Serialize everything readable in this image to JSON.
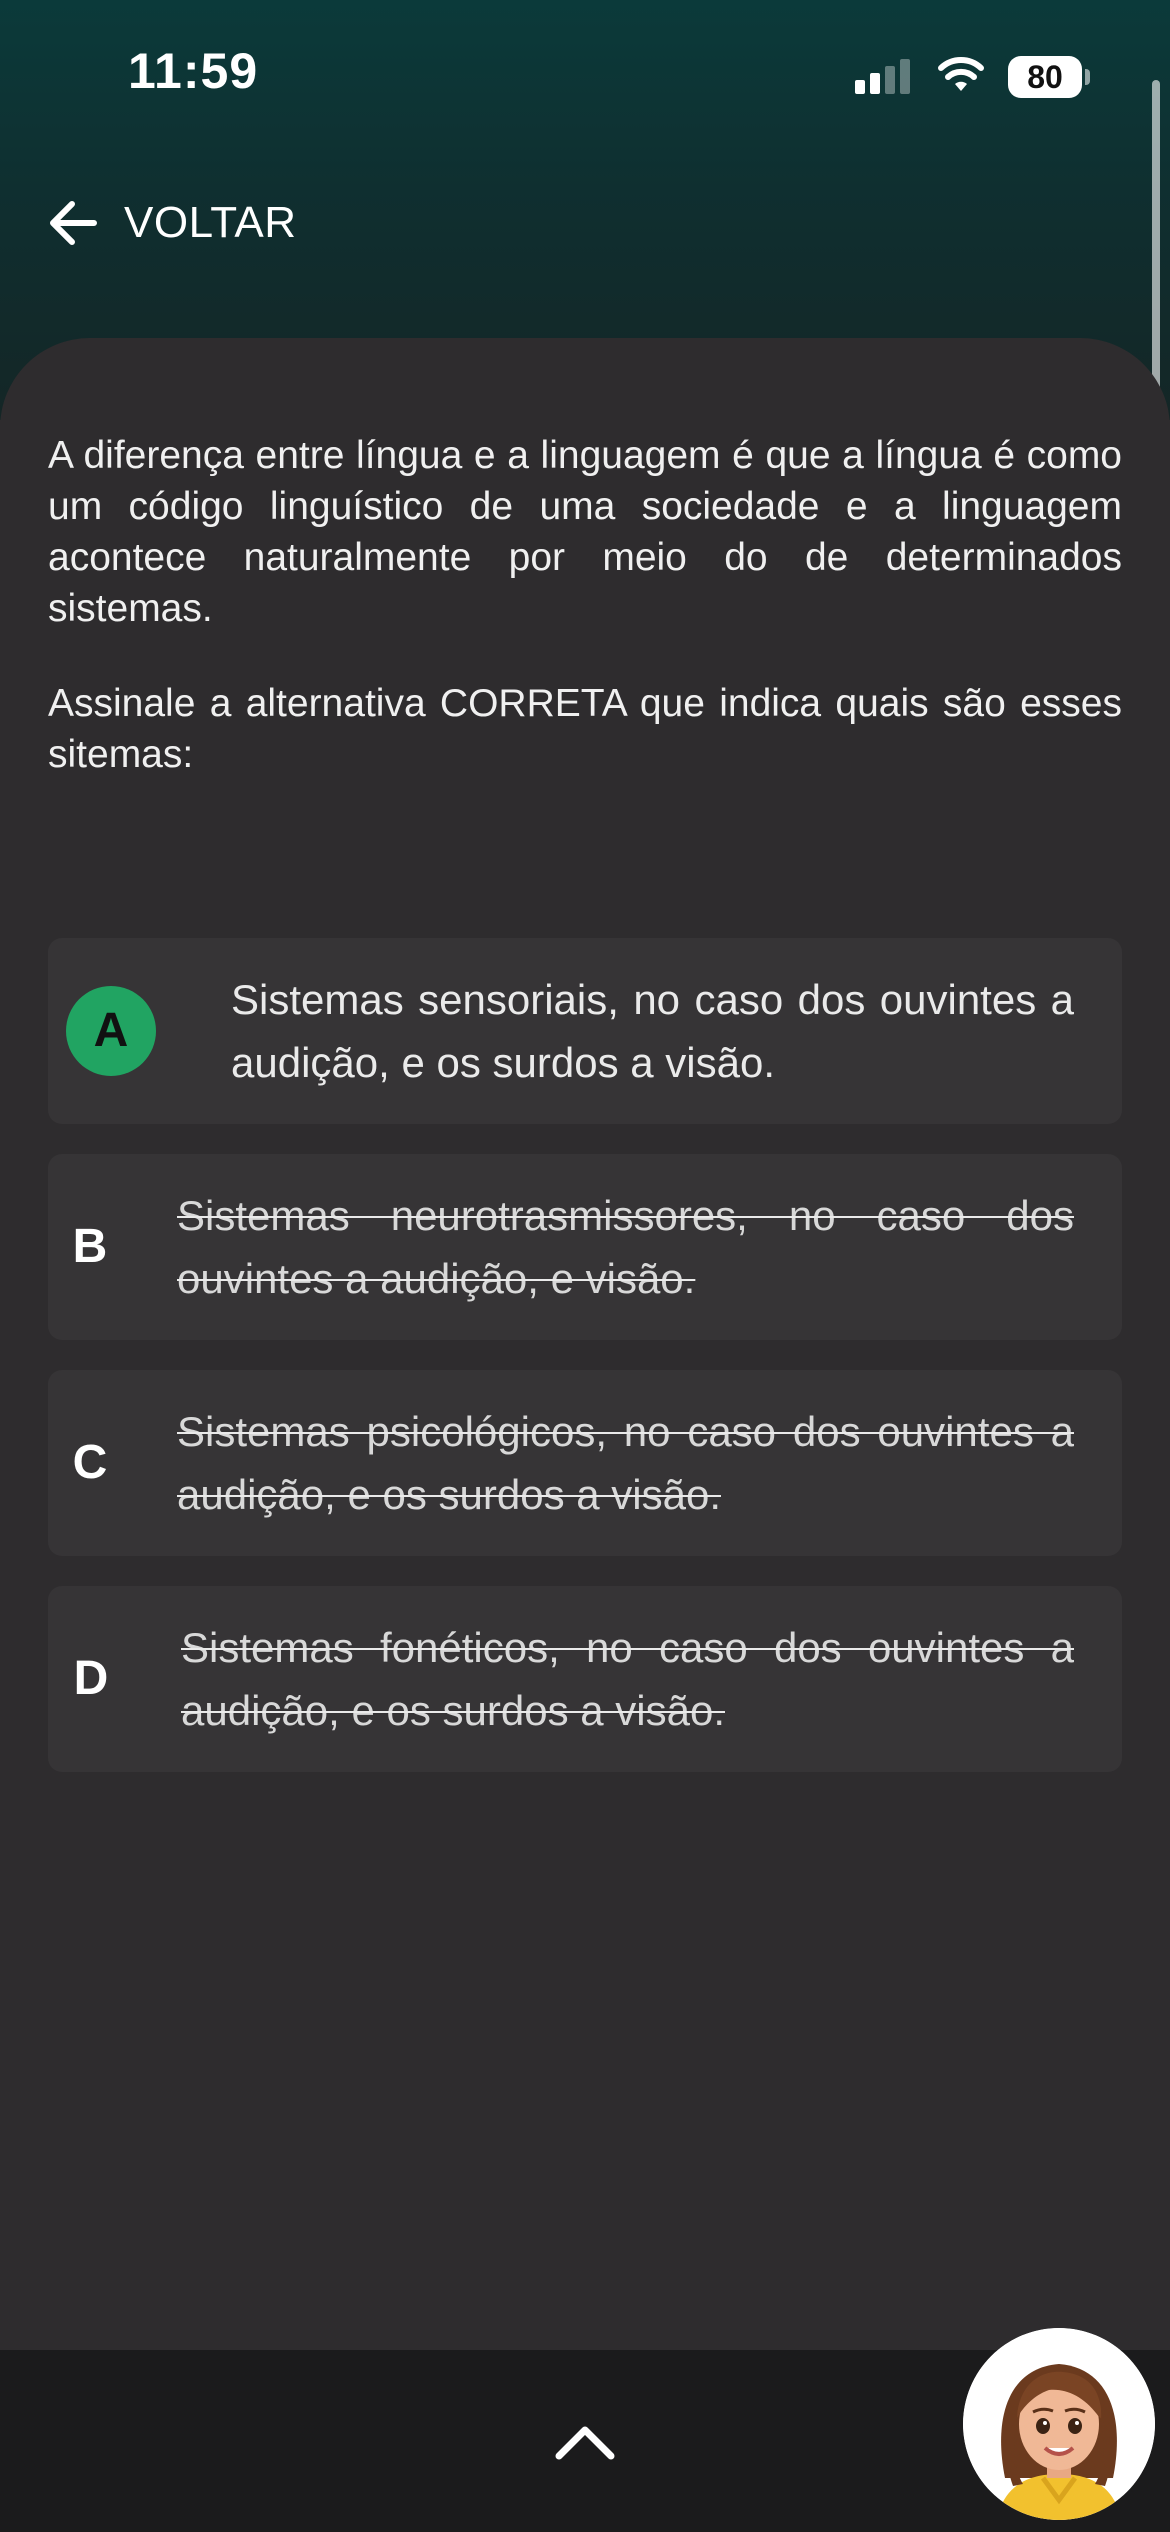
{
  "status_bar": {
    "time": "11:59",
    "battery": "80",
    "signal_icon": "cellular-signal-icon",
    "wifi_icon": "wifi-icon"
  },
  "header": {
    "back_label": "VOLTAR",
    "back_icon": "arrow-left-icon"
  },
  "question": {
    "paragraph1": "A diferença entre língua e a linguagem é que a língua é como um código linguístico de uma sociedade e a linguagem acontece naturalmente por meio do de determinados sistemas.",
    "paragraph2": "Assinale a alternativa CORRETA que indica quais são esses sitemas:"
  },
  "options": [
    {
      "letter": "A",
      "text": "Sistemas sensoriais, no caso dos ouvintes a audição, e os surdos a visão.",
      "selected": true
    },
    {
      "letter": "B",
      "text": "Sistemas neurotrasmissores, no caso dos ouvintes a audição, e visão.",
      "struck": true
    },
    {
      "letter": "C",
      "text": "Sistemas psicológicos, no caso dos ouvintes a audição, e os surdos a visão.",
      "struck": true
    },
    {
      "letter": "D",
      "text": "Sistemas fonéticos, no caso dos ouvintes a audição, e os surdos a visão.",
      "struck": true
    }
  ],
  "bottom_bar": {
    "expand_icon": "chevron-up-icon",
    "avatar_icon": "assistant-avatar"
  },
  "colors": {
    "accent_green": "#21a462",
    "background": "#2e2c2e",
    "header_teal": "#0b3a3a"
  }
}
